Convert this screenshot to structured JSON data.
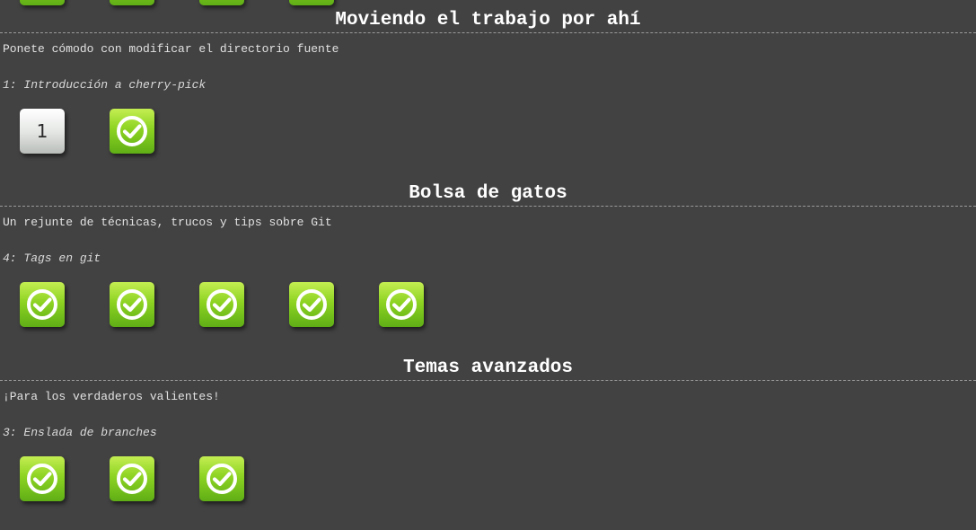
{
  "colors": {
    "background": "#424242",
    "level_complete": "#8dd322",
    "level_pending": "#e6e8e6"
  },
  "sections": [
    {
      "title": "Moviendo el trabajo por ahí",
      "description": "Ponete cómodo con modificar el directorio fuente",
      "current_level": "1: Introducción a cherry-pick",
      "levels": [
        {
          "label": "1",
          "completed": false,
          "icon": ""
        },
        {
          "label": "",
          "completed": true,
          "icon": "check-icon"
        }
      ]
    },
    {
      "title": "Bolsa de gatos",
      "description": "Un rejunte de técnicas, trucos y tips sobre Git",
      "current_level": "4: Tags en git",
      "levels": [
        {
          "label": "",
          "completed": true,
          "icon": "check-icon"
        },
        {
          "label": "",
          "completed": true,
          "icon": "check-icon"
        },
        {
          "label": "",
          "completed": true,
          "icon": "check-icon"
        },
        {
          "label": "",
          "completed": true,
          "icon": "check-icon"
        },
        {
          "label": "",
          "completed": true,
          "icon": "check-icon"
        }
      ]
    },
    {
      "title": "Temas avanzados",
      "description": "¡Para los verdaderos valientes!",
      "current_level": "3: Enslada de branches",
      "levels": [
        {
          "label": "",
          "completed": true,
          "icon": "check-icon"
        },
        {
          "label": "",
          "completed": true,
          "icon": "check-icon"
        },
        {
          "label": "",
          "completed": true,
          "icon": "check-icon"
        }
      ]
    }
  ]
}
